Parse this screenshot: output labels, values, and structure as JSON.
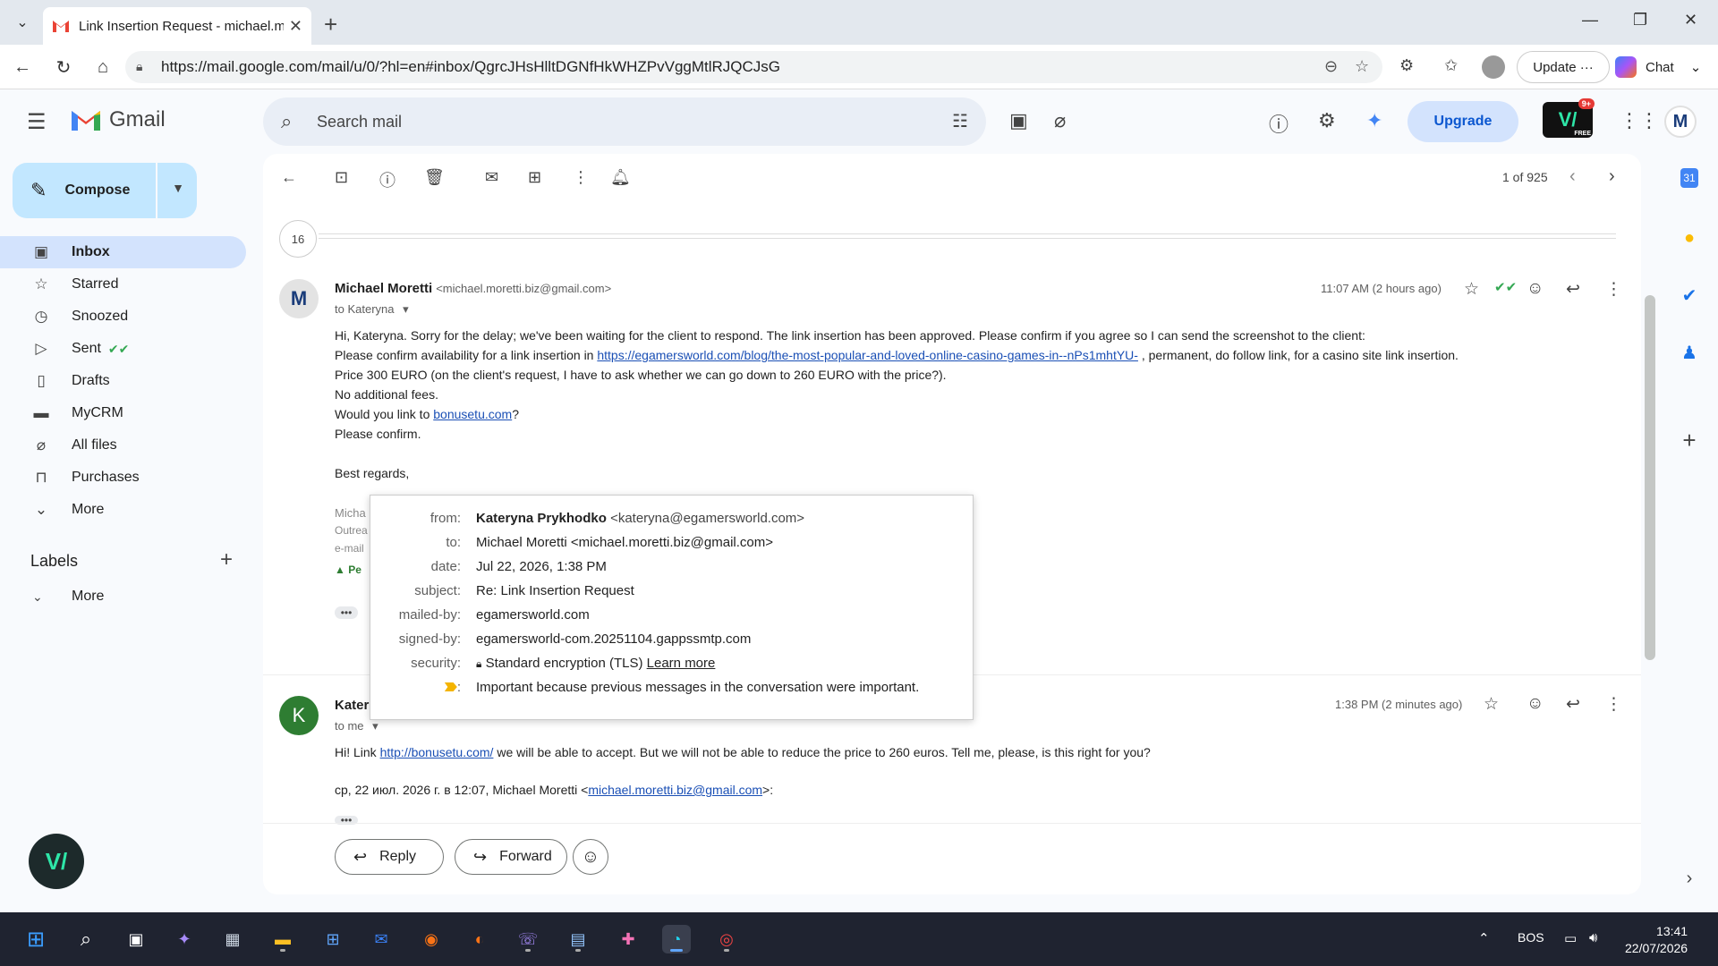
{
  "browser": {
    "tab_title": "Link Insertion Request - michael.m",
    "url": "https://mail.google.com/mail/u/0/?hl=en#inbox/QgrcJHsHlltDGNfHkWHZPvVggMtlRJQCJsG",
    "update_label": "Update",
    "chat_label": "Chat"
  },
  "gmail": {
    "logo_text": "Gmail",
    "search_placeholder": "Search mail",
    "upgrade_label": "Upgrade",
    "badge_count": "9+",
    "badge_free": "FREE",
    "account_initial": "M"
  },
  "sidebar": {
    "compose_label": "Compose",
    "items": [
      {
        "label": "Inbox",
        "icon": "inbox-icon",
        "active": true
      },
      {
        "label": "Starred",
        "icon": "star-icon"
      },
      {
        "label": "Snoozed",
        "icon": "clock-icon"
      },
      {
        "label": "Sent",
        "icon": "send-icon"
      },
      {
        "label": "Drafts",
        "icon": "draft-icon"
      },
      {
        "label": "MyCRM",
        "icon": "contact-icon"
      },
      {
        "label": "All files",
        "icon": "paperclip-icon"
      },
      {
        "label": "Purchases",
        "icon": "bag-icon"
      },
      {
        "label": "More",
        "icon": "chevron-down-icon"
      }
    ],
    "labels_heading": "Labels",
    "labels_more": "More"
  },
  "toolbar": {
    "pager_text": "1 of 925"
  },
  "thread": {
    "collapsed_count": "16",
    "message1": {
      "avatar_initial": "M",
      "sender_name": "Michael Moretti",
      "sender_email": "<michael.moretti.biz@gmail.com>",
      "to": "to Kateryna",
      "time": "11:07 AM (2 hours ago)",
      "line1": "Hi, Kateryna. Sorry for the delay; we've been waiting for the client to respond. The link insertion has been approved. Please confirm if you agree so I can send the screenshot to the client:",
      "line2_prefix": "Please confirm availability for a link insertion in ",
      "line2_link": "https://egamersworld.com/blog/the-most-popular-and-loved-online-casino-games-in--nPs1mhtYU-",
      "line2_suffix": " , permanent, do follow link, for a casino site link insertion.",
      "line3": "Price  300 EURO (on the client's request, I have to ask whether we can go down to 260 EURO with the price?).",
      "line4": "No additional fees.",
      "line5_prefix": "Would you link to ",
      "line5_link": "bonusetu.com",
      "line5_suffix": "?",
      "line6": "Please confirm.",
      "line7": "Best regards,",
      "sig1": "Micha",
      "sig2": "Outrea",
      "sig3": "e-mail",
      "sig4": "Pe"
    },
    "popup": {
      "from_label": "from:",
      "from_name": "Kateryna Prykhodko",
      "from_email": "<kateryna@egamersworld.com>",
      "to_label": "to:",
      "to_value": "Michael Moretti <michael.moretti.biz@gmail.com>",
      "date_label": "date:",
      "date_value": "Jul 22, 2026, 1:38 PM",
      "subject_label": "subject:",
      "subject_value": "Re: Link Insertion Request",
      "mailedby_label": "mailed-by:",
      "mailedby_value": "egamersworld.com",
      "signedby_label": "signed-by:",
      "signedby_value": "egamersworld-com.20251104.gappssmtp.com",
      "security_label": "security:",
      "security_value": "Standard encryption (TLS)",
      "security_link": "Learn more",
      "importance_label": ":",
      "importance_value": "Important because previous messages in the conversation were important."
    },
    "message2": {
      "avatar_initial": "K",
      "sender_name": "Kater",
      "to": "to me",
      "time": "1:38 PM (2 minutes ago)",
      "line1_prefix": "Hi! Link ",
      "line1_link": "http://bonusetu.com/",
      "line1_suffix": " we will be able to accept. But we will not be able to reduce the price to 260 euros. Tell me, please, is this right for you?",
      "quote_prefix": "ср, 22 июл. 2026 г. в 12:07, Michael Moretti <",
      "quote_link": "michael.moretti.biz@gmail.com",
      "quote_suffix": ">:"
    },
    "reply_label": "Reply",
    "forward_label": "Forward"
  },
  "taskbar": {
    "lang": "BOS",
    "time": "13:41",
    "date": "22/07/2026"
  },
  "colors": {
    "accent_blue": "#0b57d0",
    "compose_bg": "#c2e7ff",
    "active_nav": "#d3e3fd",
    "avatar_m": "#e3e3e3",
    "avatar_k": "#2e7d32"
  }
}
